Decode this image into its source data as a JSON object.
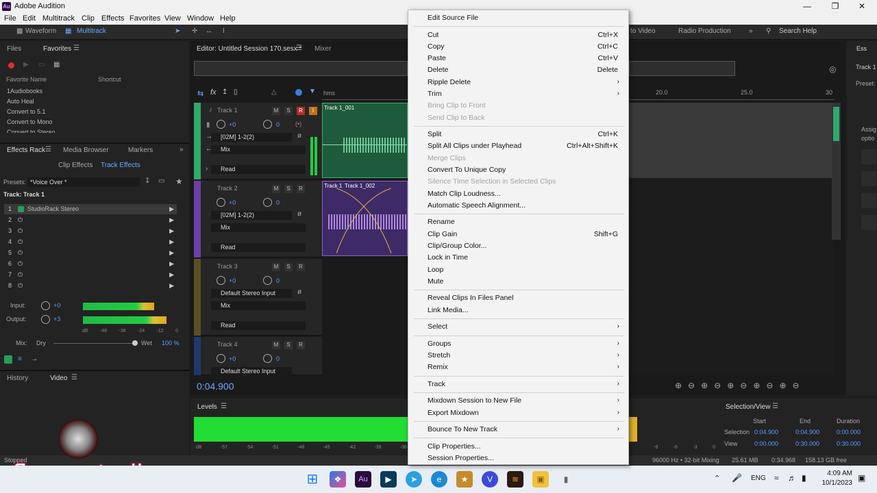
{
  "titlebar": {
    "app_logo": "Au",
    "title": "Adobe Audition"
  },
  "menubar": {
    "items": [
      "File",
      "Edit",
      "Multitrack",
      "Clip",
      "Effects",
      "Favorites",
      "View",
      "Window",
      "Help"
    ]
  },
  "toolbar": {
    "waveform": "Waveform",
    "multitrack": "Multitrack",
    "to_video": "to Video",
    "radio_production": "Radio Production",
    "search_placeholder": "Search Help"
  },
  "left_panel": {
    "tabs": {
      "files": "Files",
      "favorites": "Favorites"
    },
    "columns": {
      "name": "Favorite Name",
      "shortcut": "Shortcut"
    },
    "favorites": [
      "1Audiobooks",
      "Auto Heal",
      "Convert to 5.1",
      "Convert to Mono",
      "Convert to Stereo"
    ],
    "rack_tabs": {
      "effects_rack": "Effects Rack",
      "media_browser": "Media Browser",
      "markers": "Markers"
    },
    "sub_tabs": {
      "clip_effects": "Clip Effects",
      "track_effects": "Track Effects"
    },
    "presets_label": "Presets:",
    "preset_value": "*Voice Over *",
    "track_label": "Track: Track 1",
    "slots": [
      {
        "n": "1",
        "name": "StudioRack Stereo"
      },
      {
        "n": "2",
        "name": ""
      },
      {
        "n": "3",
        "name": ""
      },
      {
        "n": "4",
        "name": ""
      },
      {
        "n": "5",
        "name": ""
      },
      {
        "n": "6",
        "name": ""
      },
      {
        "n": "7",
        "name": ""
      },
      {
        "n": "8",
        "name": ""
      }
    ],
    "input_label": "Input:",
    "input_value": "+0",
    "output_label": "Output:",
    "output_value": "+3",
    "scale": [
      "dB",
      "-48",
      "-36",
      "-24",
      "-12",
      "0"
    ],
    "mix_label": "Mix:",
    "dry": "Dry",
    "wet": "Wet",
    "wet_value": "100 %",
    "history": "History",
    "video": "Video"
  },
  "editor": {
    "tab_title": "Editor: Untitled Session 170.sesx *",
    "mixer_tab": "Mixer",
    "ruler_unit": "hms",
    "ruler_marks": [
      "20.0",
      "25.0",
      "30"
    ],
    "time": "0:04.900",
    "tracks": [
      {
        "name": "Track 1",
        "vol": "+0",
        "pan": "0",
        "input": "[02M] 1-2(2)",
        "output": "Mix",
        "mode": "Read",
        "clip": "Track 1_001"
      },
      {
        "name": "Track 2",
        "vol": "+0",
        "pan": "0",
        "input": "[02M] 1-2(2)",
        "output": "Mix",
        "mode": "Read",
        "clip": "Track 1_002",
        "clip_b": "Track 1"
      },
      {
        "name": "Track 3",
        "vol": "+0",
        "pan": "0",
        "input": "Default Stereo Input",
        "output": "Mix",
        "mode": "Read"
      },
      {
        "name": "Track 4",
        "vol": "+0",
        "pan": "0",
        "input": "Default Stereo Input"
      }
    ],
    "right_panel": {
      "tab": "Ess",
      "track": "Track 1",
      "preset": "Preset:",
      "assign": "Assig",
      "options": "optio"
    }
  },
  "context_menu": [
    {
      "label": "Edit Source File"
    },
    {
      "sep": true
    },
    {
      "label": "Cut",
      "shortcut": "Ctrl+X"
    },
    {
      "label": "Copy",
      "shortcut": "Ctrl+C"
    },
    {
      "label": "Paste",
      "shortcut": "Ctrl+V"
    },
    {
      "label": "Delete",
      "shortcut": "Delete"
    },
    {
      "label": "Ripple Delete",
      "submenu": true
    },
    {
      "label": "Trim",
      "submenu": true
    },
    {
      "label": "Bring Clip to Front",
      "disabled": true
    },
    {
      "label": "Send Clip to Back",
      "disabled": true
    },
    {
      "sep": true
    },
    {
      "label": "Split",
      "shortcut": "Ctrl+K"
    },
    {
      "label": "Split All Clips under Playhead",
      "shortcut": "Ctrl+Alt+Shift+K"
    },
    {
      "label": "Merge Clips",
      "disabled": true
    },
    {
      "label": "Convert To Unique Copy"
    },
    {
      "label": "Silence Time Selection in Selected Clips",
      "disabled": true
    },
    {
      "label": "Match Clip Loudness..."
    },
    {
      "label": "Automatic Speech Alignment..."
    },
    {
      "sep": true
    },
    {
      "label": "Rename"
    },
    {
      "label": "Clip Gain",
      "shortcut": "Shift+G"
    },
    {
      "label": "Clip/Group Color..."
    },
    {
      "label": "Lock in Time"
    },
    {
      "label": "Loop"
    },
    {
      "label": "Mute"
    },
    {
      "sep": true
    },
    {
      "label": "Reveal Clips In Files Panel"
    },
    {
      "label": "Link Media..."
    },
    {
      "sep": true
    },
    {
      "label": "Select",
      "submenu": true
    },
    {
      "sep": true
    },
    {
      "label": "Groups",
      "submenu": true
    },
    {
      "label": "Stretch",
      "submenu": true
    },
    {
      "label": "Remix",
      "submenu": true
    },
    {
      "sep": true
    },
    {
      "label": "Track",
      "submenu": true
    },
    {
      "sep": true
    },
    {
      "label": "Mixdown Session to New File",
      "submenu": true
    },
    {
      "label": "Export Mixdown",
      "submenu": true
    },
    {
      "sep": true
    },
    {
      "label": "Bounce To New Track",
      "submenu": true
    },
    {
      "sep": true
    },
    {
      "label": "Clip Properties..."
    },
    {
      "label": "Session Properties..."
    }
  ],
  "levels": {
    "title": "Levels",
    "scale": [
      "dB",
      "-57",
      "-54",
      "-51",
      "-48",
      "-45",
      "-42",
      "-39",
      "-36",
      "-9",
      "-6",
      "-3",
      "0"
    ]
  },
  "selection_view": {
    "title": "Selection/View",
    "cols": [
      "Start",
      "End",
      "Duration"
    ],
    "selection_label": "Selection",
    "selection": [
      "0:04.900",
      "0:04.900",
      "0:00.000"
    ],
    "view_label": "View",
    "view": [
      "0:00.000",
      "0:30.000",
      "0:30.000"
    ]
  },
  "statusbar": {
    "left": "Stopped",
    "format": "96000 Hz • 32-bit Mixing",
    "mem": "25.61 MB",
    "duration": "0:34.968",
    "free": "158.13 GB free"
  },
  "watermark": "flame studio",
  "taskbar": {
    "lang": "ENG",
    "time": "4:09 AM",
    "date": "10/1/2023"
  }
}
